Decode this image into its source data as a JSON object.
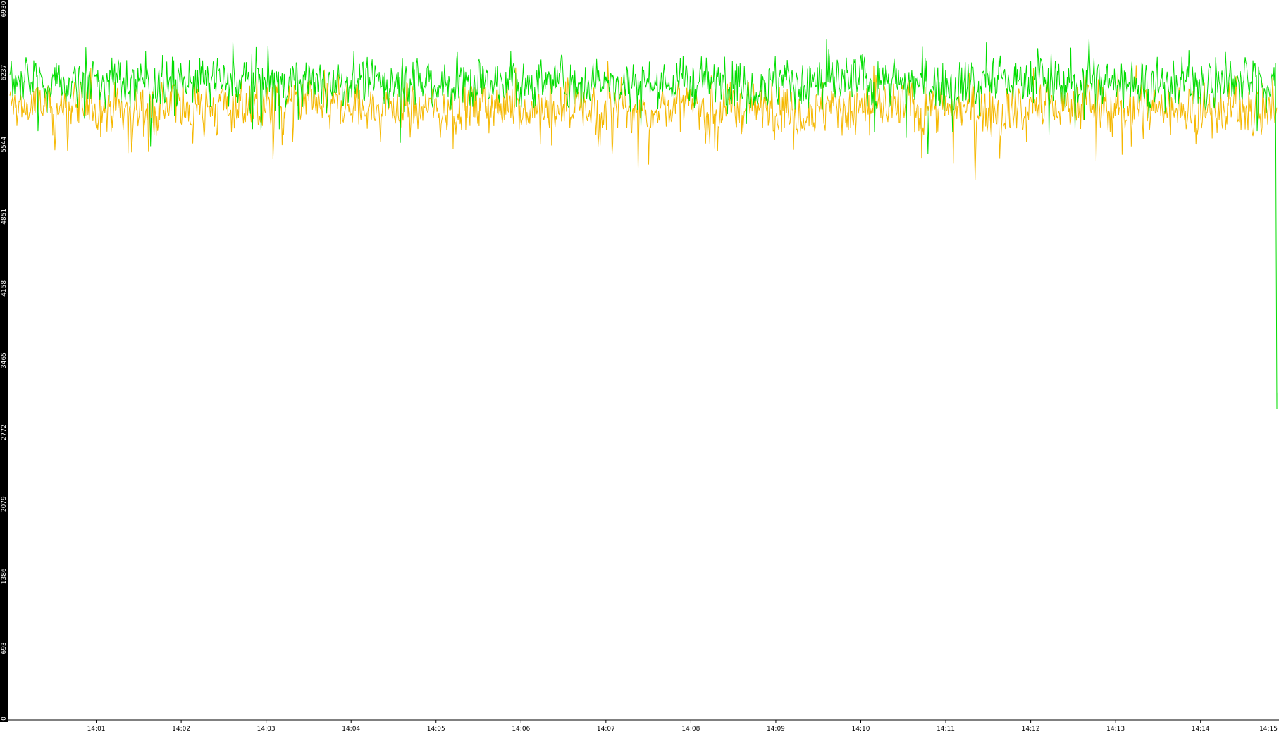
{
  "chart_data": {
    "type": "line",
    "title": "",
    "xlabel": "",
    "ylabel": "",
    "ylim": [
      0,
      6930
    ],
    "y_ticks": [
      "0",
      "693",
      "1386",
      "2079",
      "2772",
      "3465",
      "4158",
      "4851",
      "5544",
      "6237",
      "6930"
    ],
    "x_ticks": [
      "14:01",
      "14:02",
      "14:03",
      "14:04",
      "14:05",
      "14:06",
      "14:07",
      "14:08",
      "14:09",
      "14:10",
      "14:11",
      "14:12",
      "14:13",
      "14:14",
      "14:15"
    ],
    "x_range": [
      "14:00",
      "14:15"
    ],
    "grid": false,
    "legend": "none",
    "series": [
      {
        "color": "#00dd00",
        "typical_range": [
          5800,
          6600
        ],
        "mean": 6150,
        "end_value": 3000
      },
      {
        "color": "#f5b800",
        "typical_range": [
          5500,
          6300
        ],
        "mean": 5900,
        "end_value": 5900
      }
    ]
  }
}
